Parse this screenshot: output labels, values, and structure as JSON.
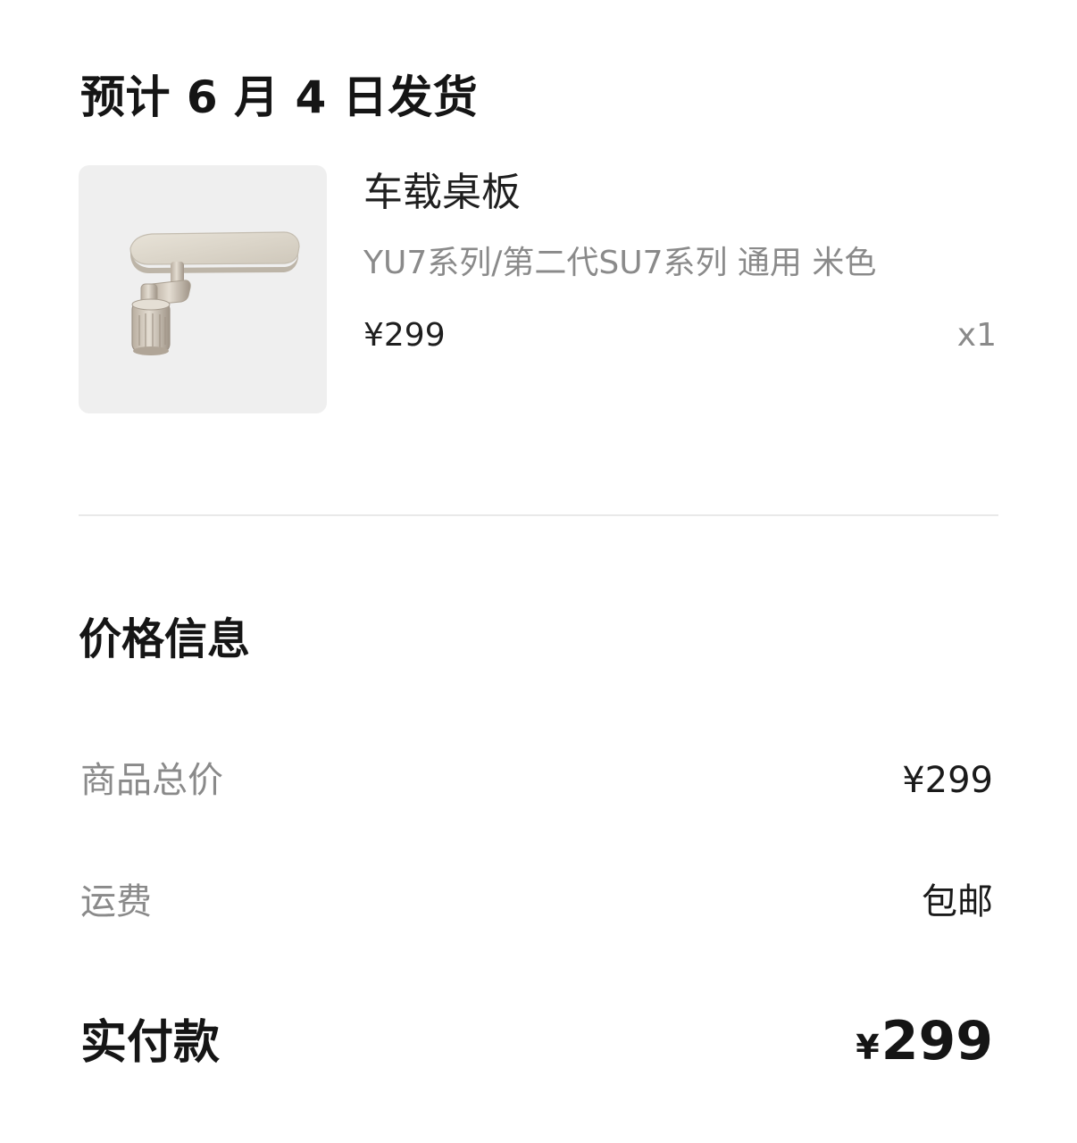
{
  "shipping": {
    "title": "预计 6 月 4 日发货"
  },
  "product": {
    "name": "车载桌板",
    "spec": "YU7系列/第二代SU7系列 通用 米色",
    "price": "¥299",
    "quantity": "x1",
    "image_icon": "car-tray-table-image"
  },
  "price_info": {
    "title": "价格信息",
    "subtotal_label": "商品总价",
    "subtotal_value": "¥299",
    "shipping_label": "运费",
    "shipping_value": "包邮",
    "paid_label": "实付款",
    "paid_currency": "¥",
    "paid_amount": "299"
  },
  "colors": {
    "background": "#ffffff",
    "image_background": "#efefef",
    "primary_text": "#151515",
    "secondary_text": "#8a8a8a",
    "divider": "#e9e9e9",
    "product_color": "#d9d3c7"
  }
}
